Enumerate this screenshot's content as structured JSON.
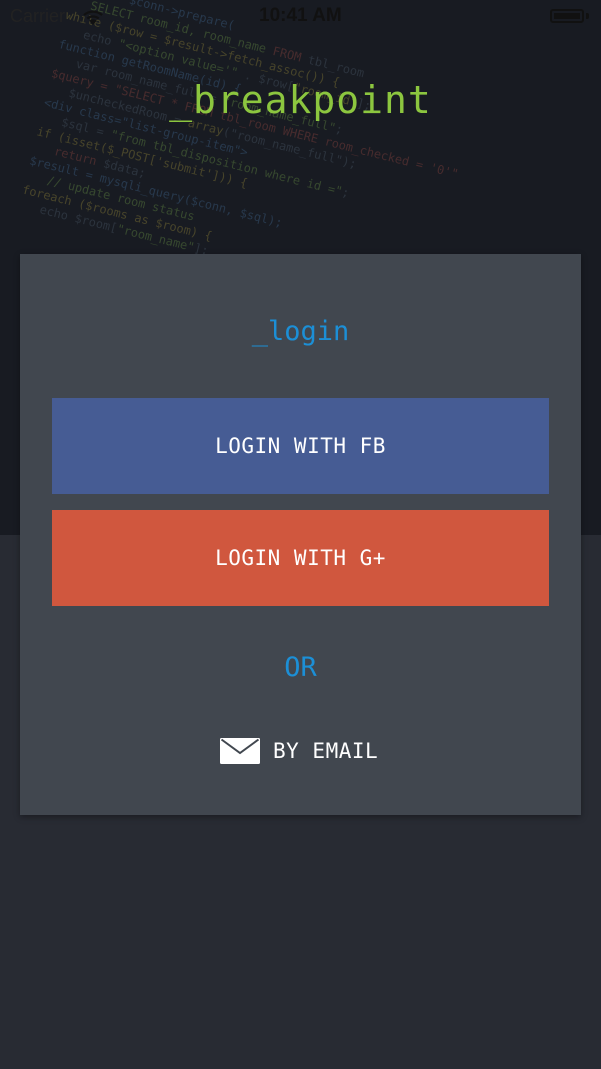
{
  "status_bar": {
    "carrier": "Carrier",
    "time": "10:41 AM"
  },
  "app": {
    "title": "_breakpoint",
    "title_color": "#8cc63f"
  },
  "login_card": {
    "heading": "_login",
    "facebook_button": "LOGIN WITH FB",
    "google_button": "LOGIN WITH G+",
    "separator": "OR",
    "email_link": "BY EMAIL"
  },
  "colors": {
    "accent_blue": "#1c8fd6",
    "facebook_blue": "#465c94",
    "google_red": "#d0573e",
    "card_background": "#41474f",
    "page_background": "#282b33"
  },
  "icons": {
    "wifi": "wifi-icon",
    "battery": "battery-icon",
    "email": "envelope-icon"
  }
}
